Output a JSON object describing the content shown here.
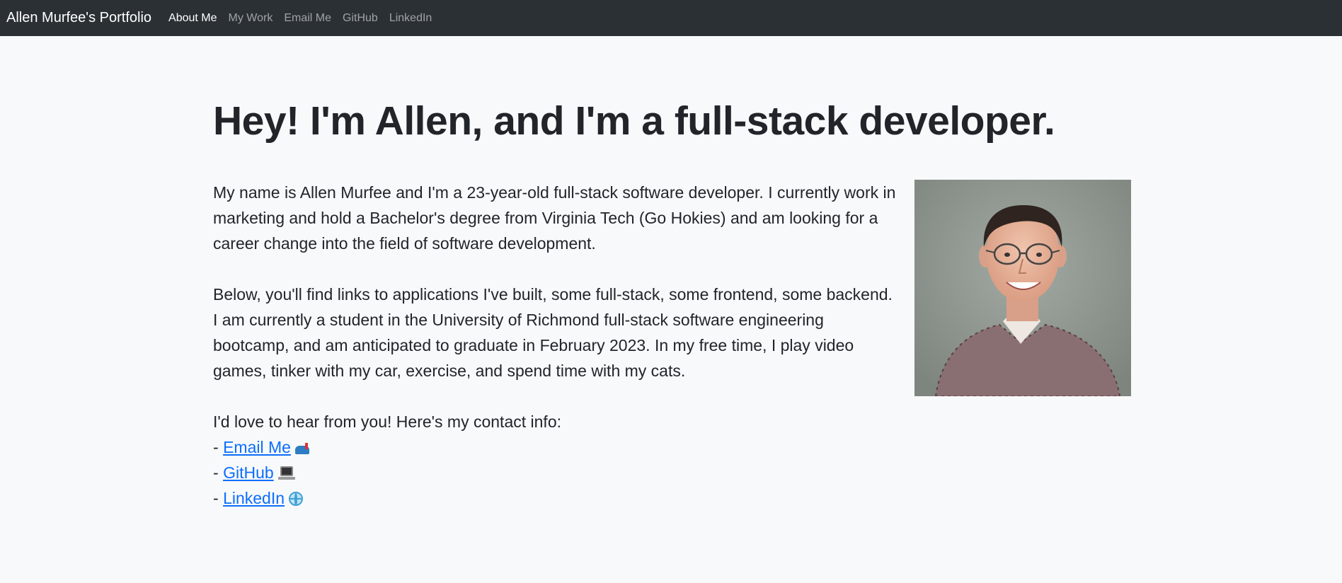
{
  "navbar": {
    "brand": "Allen Murfee's Portfolio",
    "links": [
      "About Me",
      "My Work",
      "Email Me",
      "GitHub",
      "LinkedIn"
    ],
    "active_link": "About Me"
  },
  "main": {
    "headline": "Hey! I'm Allen, and I'm a full-stack developer.",
    "paragraphs": [
      "My name is Allen Murfee and I'm a 23-year-old full-stack software developer. I currently work in marketing and hold a Bachelor's degree from Virginia Tech (Go Hokies) and am looking for a career change into the field of software development.",
      "Below, you'll find links to applications I've built, some full-stack, some frontend, some backend. I am currently a student in the University of Richmond full-stack software engineering bootcamp, and am anticipated to graduate in February 2023. In my free time, I play video games, tinker with my car, exercise, and spend time with my cats."
    ],
    "contact_intro": "I'd love to hear from you! Here's my contact info:",
    "contact_prefix": "- ",
    "contacts": [
      {
        "label": "Email Me",
        "icon": "mailbox-icon"
      },
      {
        "label": "GitHub",
        "icon": "laptop-icon"
      },
      {
        "label": "LinkedIn",
        "icon": "globe-icon"
      }
    ]
  },
  "colors": {
    "navbar_bg": "#2b3035",
    "page_bg": "#f8f9fa",
    "link": "#0d6efd",
    "text": "#212529"
  }
}
